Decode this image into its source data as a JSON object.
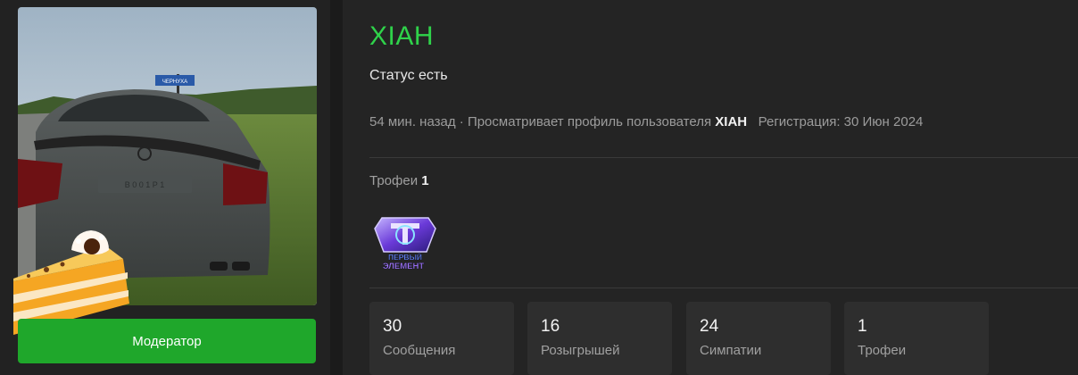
{
  "profile": {
    "username": "XIAH",
    "status": "Статус есть",
    "last_seen": "54 мин. назад",
    "activity_prefix": "Просматривает профиль пользователя",
    "activity_user": "XIAH",
    "registration_label": "Регистрация:",
    "registration_date": "30 Июн 2024",
    "role_button": "Модератор",
    "avatar_sign_text": "ЧЕРНУХА",
    "plate_text": "В 0 0 1 Р 1"
  },
  "trophies": {
    "label": "Трофеи",
    "count": "1",
    "items": [
      {
        "icon": "first-element-trophy-icon",
        "lines": [
          "ПЕРВЫЙ",
          "ЭЛЕМЕНТ"
        ]
      }
    ]
  },
  "stats": [
    {
      "value": "30",
      "label": "Сообщения"
    },
    {
      "value": "16",
      "label": "Розыгрышей"
    },
    {
      "value": "24",
      "label": "Симпатии"
    },
    {
      "value": "1",
      "label": "Трофеи"
    }
  ],
  "colors": {
    "accent_green": "#2fd24a",
    "button_green": "#1fa72b",
    "panel": "#242424",
    "stat_box": "#2e2e2e"
  }
}
